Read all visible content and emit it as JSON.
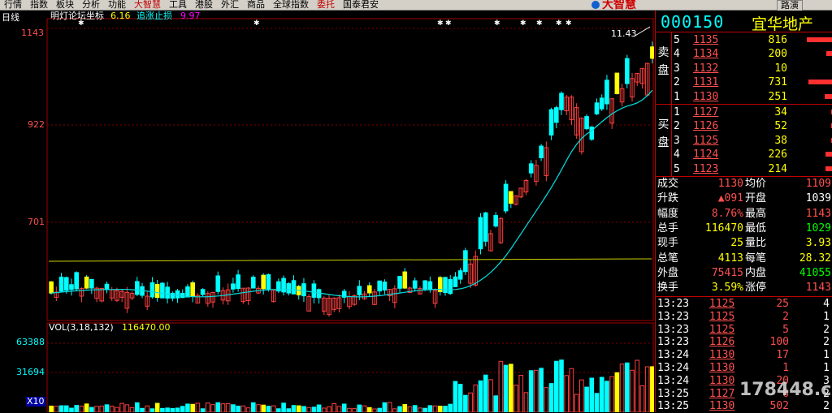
{
  "menu": [
    "行情",
    "指数",
    "板块",
    "分析",
    "功能",
    "大智慧",
    "工具",
    "港股",
    "外汇",
    "商品",
    "全球指数",
    "委托",
    "国泰君安"
  ],
  "logo_text": "大智慧",
  "nav_btn": "路演",
  "chart": {
    "period": "日线",
    "indicator_title": "明灯论坛坐标",
    "ind1_value": "6.16",
    "ind2_label": "追涨止损",
    "ind2_value": "9.97",
    "y_labels": [
      "1143",
      "922",
      "701"
    ],
    "high_marker": "11.43",
    "vol_title": "VOL(3,18,132)",
    "vol_value": "116470.00",
    "vol_labels": [
      "63388",
      "31694"
    ],
    "vol_unit": "X10",
    "marks": {
      "gao": "高",
      "suo": "缩",
      "jiang": "将",
      "guan": "观",
      "bai": "百",
      "di": "低"
    }
  },
  "quote": {
    "code": "000150",
    "name": "宜华地产",
    "sell_label": "卖盘",
    "buy_label": "买盘",
    "sells": [
      {
        "level": "5",
        "price": "1135",
        "vol": "816",
        "bar": 0.8
      },
      {
        "level": "4",
        "price": "1134",
        "vol": "200",
        "bar": 0.2
      },
      {
        "level": "3",
        "price": "1132",
        "vol": "10",
        "bar": 0.02
      },
      {
        "level": "2",
        "price": "1131",
        "vol": "731",
        "bar": 0.75
      },
      {
        "level": "1",
        "price": "1130",
        "vol": "251",
        "bar": 0.25
      }
    ],
    "buys": [
      {
        "level": "1",
        "price": "1127",
        "vol": "34",
        "bar": 0.04
      },
      {
        "level": "2",
        "price": "1126",
        "vol": "52",
        "bar": 0.06
      },
      {
        "level": "3",
        "price": "1125",
        "vol": "38",
        "bar": 0.04
      },
      {
        "level": "4",
        "price": "1124",
        "vol": "226",
        "bar": 0.23
      },
      {
        "level": "5",
        "price": "1123",
        "vol": "214",
        "bar": 0.22
      }
    ],
    "stats": [
      {
        "k": "成交",
        "v": "1130",
        "vc": "#ff5050",
        "k2": "均价",
        "v2": "1109",
        "v2c": "#ff5050"
      },
      {
        "k": "升跌",
        "v": "▲091",
        "vc": "#ff5050",
        "k2": "开盘",
        "v2": "1039",
        "v2c": "#ffffff"
      },
      {
        "k": "幅度",
        "v": "8.76%",
        "vc": "#ff5050",
        "k2": "最高",
        "v2": "1143",
        "v2c": "#ff5050"
      },
      {
        "k": "总手",
        "v": "116470",
        "vc": "#ffff00",
        "k2": "最低",
        "v2": "1029",
        "v2c": "#00ff00"
      },
      {
        "k": "现手",
        "v": "25",
        "vc": "#ffff00",
        "k2": "量比",
        "v2": "3.93",
        "v2c": "#ffff00"
      },
      {
        "k": "总笔",
        "v": "4113",
        "vc": "#ffff00",
        "k2": "每笔",
        "v2": "28.32",
        "v2c": "#ffff00"
      },
      {
        "k": "外盘",
        "v": "75415",
        "vc": "#ff5050",
        "k2": "内盘",
        "v2": "41055",
        "v2c": "#00ff00"
      },
      {
        "k": "换手",
        "v": "3.59%",
        "vc": "#ffff00",
        "k2": "涨停",
        "v2": "1143",
        "v2c": "#ff5050"
      }
    ],
    "ticks": [
      {
        "t": "13:23",
        "p": "1125",
        "q": "25",
        "n": "4"
      },
      {
        "t": "13:23",
        "p": "1125",
        "q": "2",
        "n": "1"
      },
      {
        "t": "13:23",
        "p": "1125",
        "q": "5",
        "n": "2"
      },
      {
        "t": "13:23",
        "p": "1126",
        "q": "100",
        "n": "2"
      },
      {
        "t": "13:24",
        "p": "1130",
        "q": "17",
        "n": "1"
      },
      {
        "t": "13:24",
        "p": "1130",
        "q": "1",
        "n": "1"
      },
      {
        "t": "13:24",
        "p": "1130",
        "q": "20",
        "n": "3"
      },
      {
        "t": "13:25",
        "p": "1127",
        "q": "6",
        "n": "2"
      },
      {
        "t": "13:25",
        "p": "1130",
        "q": "502",
        "n": "2"
      }
    ]
  },
  "watermark": "178448.com"
}
